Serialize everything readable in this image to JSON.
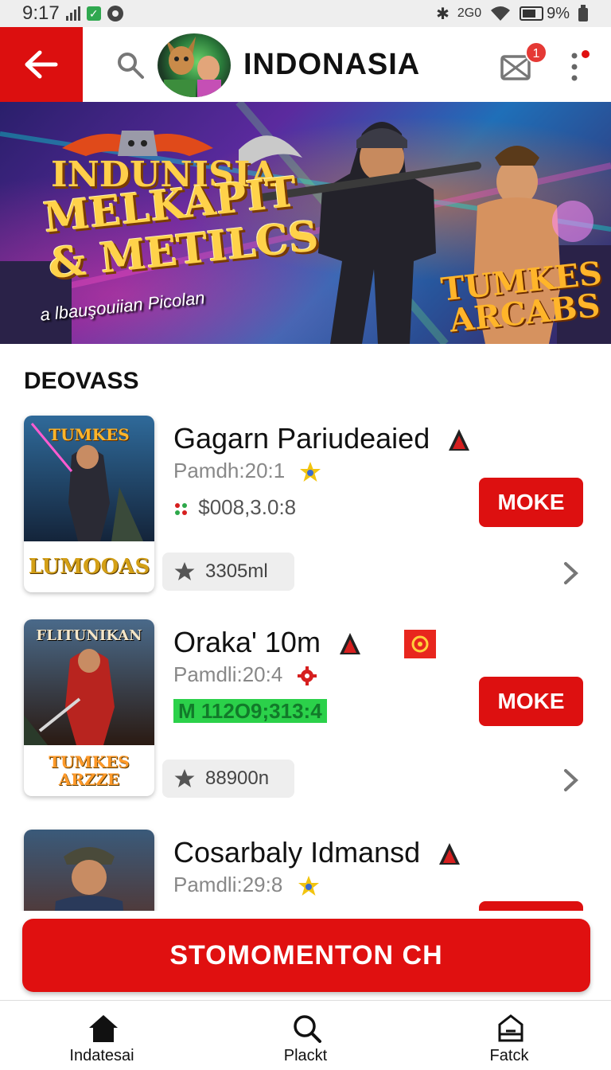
{
  "status_bar": {
    "time": "9:17",
    "right_text": "2G0",
    "battery_text": "9%"
  },
  "header": {
    "title": "INDONASIA",
    "badge_count": "1"
  },
  "banner": {
    "logo_text": "INDUNISIA",
    "title": "MELKAPIT\n& METILCS",
    "subtitle": "a lbauşouiian Picolan",
    "arcade_text": "TUMKES\nARCABS"
  },
  "section": {
    "title": "DEOVASS"
  },
  "games": [
    {
      "name": "Gagarn Pariudeaied",
      "meta": "Pamdh:20:1",
      "price": "$008,3.0:8",
      "price_style": "plain",
      "button": "MOKE",
      "count": "3305ml",
      "thumb_label": "LUMOOAS",
      "thumb_top_text": "TUMKES"
    },
    {
      "name": "Oraka' 10m",
      "meta": "Pamdli:20:4",
      "price": "M 112O9;313:4",
      "price_style": "green",
      "button": "MOKE",
      "count": "88900n",
      "thumb_label": "TUMKES ARZZE",
      "thumb_top_text": "FLITUNIKAN"
    },
    {
      "name": "Cosarbaly Idmansd",
      "meta": "Pamdli:29:8",
      "price": "",
      "price_style": "plain",
      "button": "",
      "count": "",
      "thumb_label": "",
      "thumb_top_text": ""
    }
  ],
  "cta": {
    "label": "STOMOMENTON CH"
  },
  "bottom_nav": [
    {
      "label": "Indatesai",
      "icon": "home-icon"
    },
    {
      "label": "Plackt",
      "icon": "search-icon"
    },
    {
      "label": "Fatck",
      "icon": "bag-icon"
    }
  ],
  "colors": {
    "accent": "#dd1010",
    "badge": "#e53935",
    "price_green": "#2bd14a"
  }
}
